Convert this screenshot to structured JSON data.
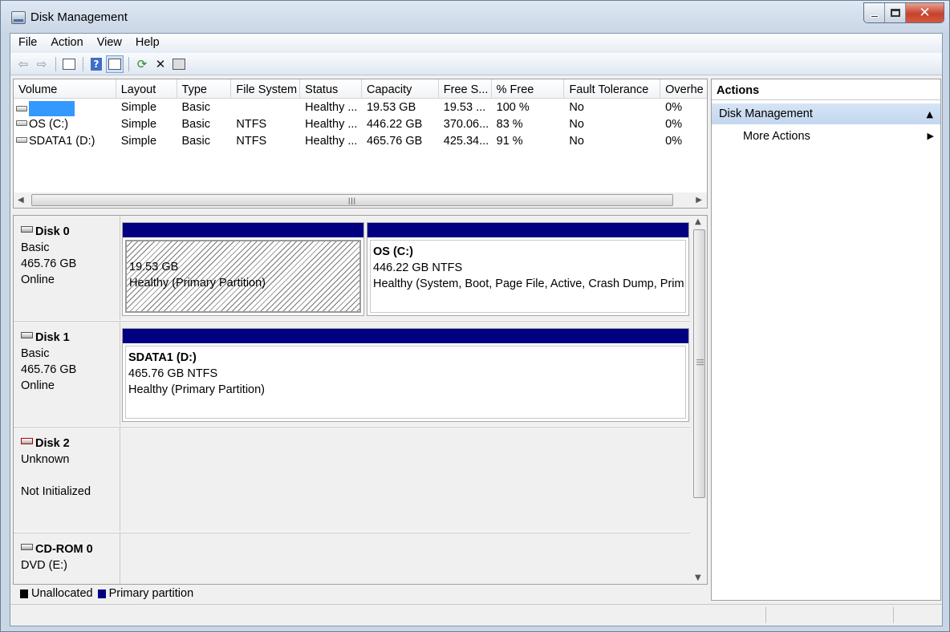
{
  "window": {
    "title": "Disk Management"
  },
  "menu": [
    "File",
    "Action",
    "View",
    "Help"
  ],
  "toolbar": [
    "back-icon",
    "forward-icon",
    "console-tree-icon",
    "help-icon",
    "disk-view-icon",
    "refresh-icon",
    "delete-icon",
    "properties-icon"
  ],
  "volumes": {
    "columns": [
      "Volume",
      "Layout",
      "Type",
      "File System",
      "Status",
      "Capacity",
      "Free S...",
      "% Free",
      "Fault Tolerance",
      "Overhe"
    ],
    "rows": [
      {
        "volume": "",
        "layout": "Simple",
        "type": "Basic",
        "fs": "",
        "status": "Healthy ...",
        "capacity": "19.53 GB",
        "free": "19.53 ...",
        "pct": "100 %",
        "fault": "No",
        "overhead": "0%"
      },
      {
        "volume": "OS (C:)",
        "layout": "Simple",
        "type": "Basic",
        "fs": "NTFS",
        "status": "Healthy ...",
        "capacity": "446.22 GB",
        "free": "370.06...",
        "pct": "83 %",
        "fault": "No",
        "overhead": "0%"
      },
      {
        "volume": "SDATA1 (D:)",
        "layout": "Simple",
        "type": "Basic",
        "fs": "NTFS",
        "status": "Healthy ...",
        "capacity": "465.76 GB",
        "free": "425.34...",
        "pct": "91 %",
        "fault": "No",
        "overhead": "0%"
      }
    ]
  },
  "disks": [
    {
      "name": "Disk 0",
      "type": "Basic",
      "size": "465.76 GB",
      "state": "Online",
      "partitions": [
        {
          "name": "",
          "size": "19.53 GB",
          "status": "Healthy (Primary Partition)"
        },
        {
          "name": "OS  (C:)",
          "size": "446.22 GB NTFS",
          "status": "Healthy (System, Boot, Page File, Active, Crash Dump, Prim"
        }
      ]
    },
    {
      "name": "Disk 1",
      "type": "Basic",
      "size": "465.76 GB",
      "state": "Online",
      "partitions": [
        {
          "name": "SDATA1  (D:)",
          "size": "465.76 GB NTFS",
          "status": "Healthy (Primary Partition)"
        }
      ]
    },
    {
      "name": "Disk 2",
      "type": "Unknown",
      "size": "",
      "state": "Not Initialized",
      "partitions": []
    },
    {
      "name": "CD-ROM 0",
      "type": "DVD (E:)",
      "size": "",
      "state": "",
      "partitions": []
    }
  ],
  "legend": [
    {
      "label": "Unallocated",
      "color": "#000000"
    },
    {
      "label": "Primary partition",
      "color": "#000080"
    }
  ],
  "actions": {
    "header": "Actions",
    "group": "Disk Management",
    "items": [
      "More Actions"
    ]
  }
}
